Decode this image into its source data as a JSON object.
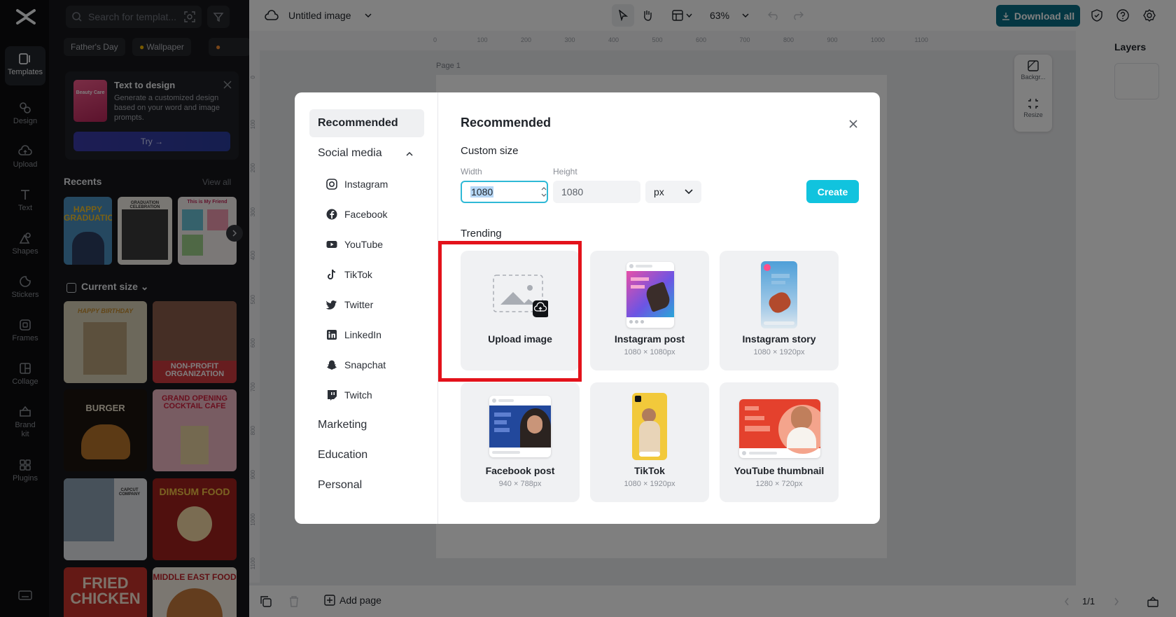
{
  "rail": {
    "items": [
      {
        "label": "Templates",
        "icon": "templates-icon",
        "active": true
      },
      {
        "label": "Design",
        "icon": "design-icon"
      },
      {
        "label": "Upload",
        "icon": "upload-icon"
      },
      {
        "label": "Text",
        "icon": "text-icon"
      },
      {
        "label": "Shapes",
        "icon": "shapes-icon"
      },
      {
        "label": "Stickers",
        "icon": "stickers-icon"
      },
      {
        "label": "Frames",
        "icon": "frames-icon"
      },
      {
        "label": "Collage",
        "icon": "collage-icon"
      },
      {
        "label": "Brand kit",
        "icon": "brand-kit-icon"
      },
      {
        "label": "Plugins",
        "icon": "plugins-icon"
      }
    ]
  },
  "panel": {
    "search_placeholder": "Search for templat...",
    "chips": [
      "Father's Day",
      "Wallpaper"
    ],
    "promo": {
      "thumb_text": "Beauty Care",
      "title": "Text to design",
      "description": "Generate a customized design based on your word and image prompts.",
      "button": "Try →"
    },
    "recents_title": "Recents",
    "recents_link": "View all",
    "current_size": "Current size",
    "recent_thumbs": [
      "HAPPY GRADUATION",
      "GRADUATION CELEBRATION",
      "This is My Friend"
    ],
    "template_thumbs": [
      "HAPPY BIRTHDAY",
      "NON-PROFIT ORGANIZATION",
      "BURGER",
      "GRAND OPENING COCKTAIL CAFE",
      "CAPCUT COMPANY",
      "DIMSUM FOOD",
      "FRIED CHICKEN",
      "MIDDLE EAST FOOD"
    ]
  },
  "topbar": {
    "doc_title": "Untitled image",
    "zoom": "63%",
    "download_label": "Download all"
  },
  "canvas": {
    "page_label": "Page 1",
    "ruler_ticks_h": [
      "0",
      "100",
      "200",
      "300",
      "400",
      "500",
      "600",
      "700",
      "800",
      "900",
      "1000",
      "1100"
    ],
    "ruler_ticks_v": [
      "0",
      "100",
      "200",
      "300",
      "400",
      "500",
      "600",
      "700",
      "800",
      "900",
      "1000",
      "1100"
    ]
  },
  "right_panel": {
    "title": "Layers",
    "tools": [
      "Backgr...",
      "Resize"
    ]
  },
  "bottombar": {
    "add_page": "Add page",
    "page_count": "1/1"
  },
  "modal": {
    "nav": {
      "selected": "Recommended",
      "social_media": "Social media",
      "social_items": [
        "Instagram",
        "Facebook",
        "YouTube",
        "TikTok",
        "Twitter",
        "LinkedIn",
        "Snapchat",
        "Twitch"
      ],
      "categories": [
        "Marketing",
        "Education",
        "Personal"
      ]
    },
    "title": "Recommended",
    "custom_size": "Custom size",
    "width_label": "Width",
    "height_label": "Height",
    "width_value": "1080",
    "height_value": "1080",
    "unit": "px",
    "create_label": "Create",
    "trending_title": "Trending",
    "cards": [
      {
        "name": "Upload image",
        "size": ""
      },
      {
        "name": "Instagram post",
        "size": "1080 × 1080px"
      },
      {
        "name": "Instagram story",
        "size": "1080 × 1920px"
      },
      {
        "name": "Facebook post",
        "size": "940 × 788px"
      },
      {
        "name": "TikTok",
        "size": "1080 × 1920px"
      },
      {
        "name": "YouTube thumbnail",
        "size": "1280 × 720px"
      }
    ]
  },
  "colors": {
    "accent": "#11c3de",
    "highlight": "#e3121b",
    "download": "#0b6f86"
  }
}
